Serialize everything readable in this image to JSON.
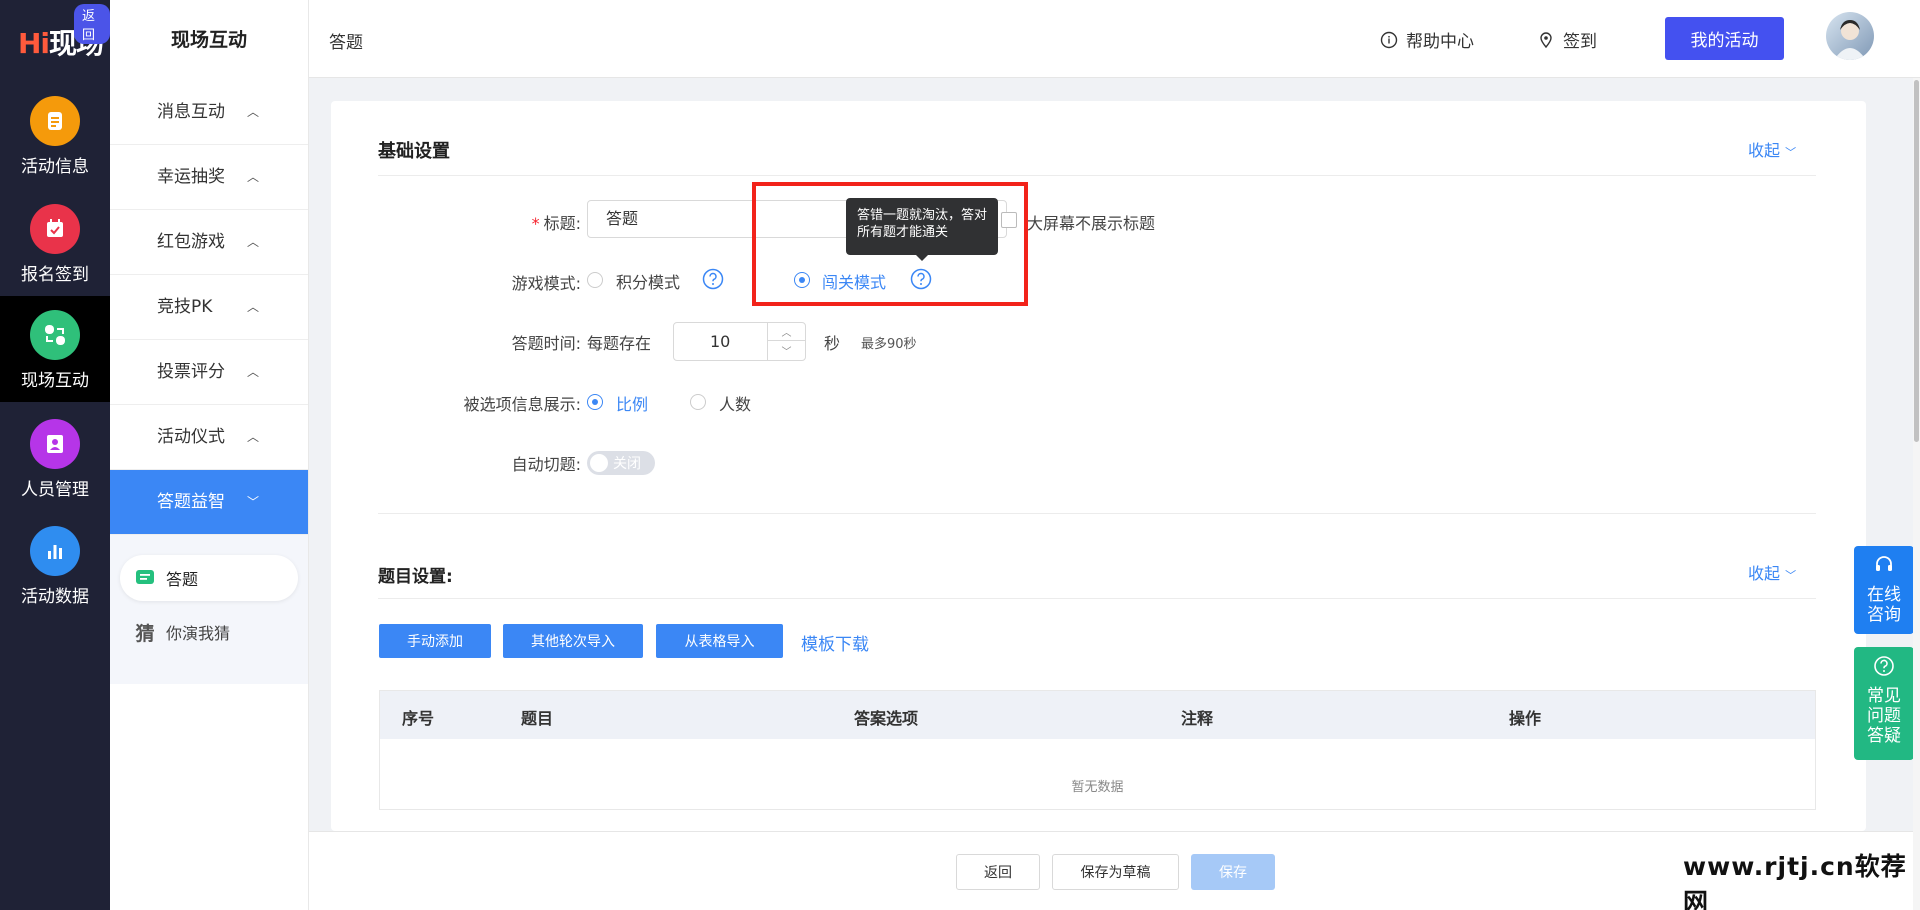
{
  "brand": {
    "logo_hi": "Hi",
    "logo_text": "现场",
    "back_badge": "返回"
  },
  "rail": {
    "items": [
      {
        "label": "活动信息",
        "icon": "document-icon",
        "color": "#f59a0b"
      },
      {
        "label": "报名签到",
        "icon": "calendar-check-icon",
        "color": "#e9334a"
      },
      {
        "label": "现场互动",
        "icon": "interaction-icon",
        "color": "#2fc07a"
      },
      {
        "label": "人员管理",
        "icon": "person-card-icon",
        "color": "#b635e8"
      },
      {
        "label": "活动数据",
        "icon": "bar-chart-icon",
        "color": "#2f8df0"
      }
    ]
  },
  "sidebar": {
    "title": "现场互动",
    "items": [
      {
        "label": "消息互动"
      },
      {
        "label": "幸运抽奖"
      },
      {
        "label": "红包游戏"
      },
      {
        "label": "竞技PK"
      },
      {
        "label": "投票评分"
      },
      {
        "label": "活动仪式"
      },
      {
        "label": "答题益智"
      }
    ],
    "sub_items": [
      {
        "label": "答题",
        "icon": "chat-list-icon"
      },
      {
        "label": "你演我猜",
        "icon_glyph": "猜"
      }
    ]
  },
  "header": {
    "breadcrumb": "答题",
    "help": "帮助中心",
    "checkin": "签到",
    "my_activity": "我的活动"
  },
  "basic": {
    "title": "基础设置",
    "collapse": "收起",
    "title_label": "标题:",
    "title_required": "*",
    "title_value": "答题",
    "hide_title_label": "大屏幕不展示标题",
    "mode_label": "游戏模式:",
    "mode_score": "积分模式",
    "mode_level": "闯关模式",
    "tooltip": "答错一题就淘汰，答对所有题才能通关",
    "time_label": "答题时间:",
    "time_prefix": "每题存在",
    "time_value": "10",
    "time_unit": "秒",
    "time_hint": "最多90秒",
    "display_label": "被选项信息展示:",
    "display_ratio": "比例",
    "display_count": "人数",
    "auto_label": "自动切题:",
    "auto_state": "关闭"
  },
  "questions": {
    "title": "题目设置:",
    "collapse": "收起",
    "btn_manual": "手动添加",
    "btn_other": "其他轮次导入",
    "btn_sheet": "从表格导入",
    "template": "模板下载",
    "columns": [
      "序号",
      "题目",
      "答案选项",
      "注释",
      "操作"
    ],
    "empty": "暂无数据"
  },
  "footer": {
    "back": "返回",
    "draft": "保存为草稿",
    "save": "保存"
  },
  "float": {
    "consult": "在线咨询",
    "faq": "常见问题答疑"
  },
  "watermark": "www.rjtj.cn软荐网",
  "colors": {
    "primary": "#3b87f5",
    "header_button": "#4451f0",
    "rail_bg": "#1f2236",
    "highlight": "#f2231a"
  }
}
